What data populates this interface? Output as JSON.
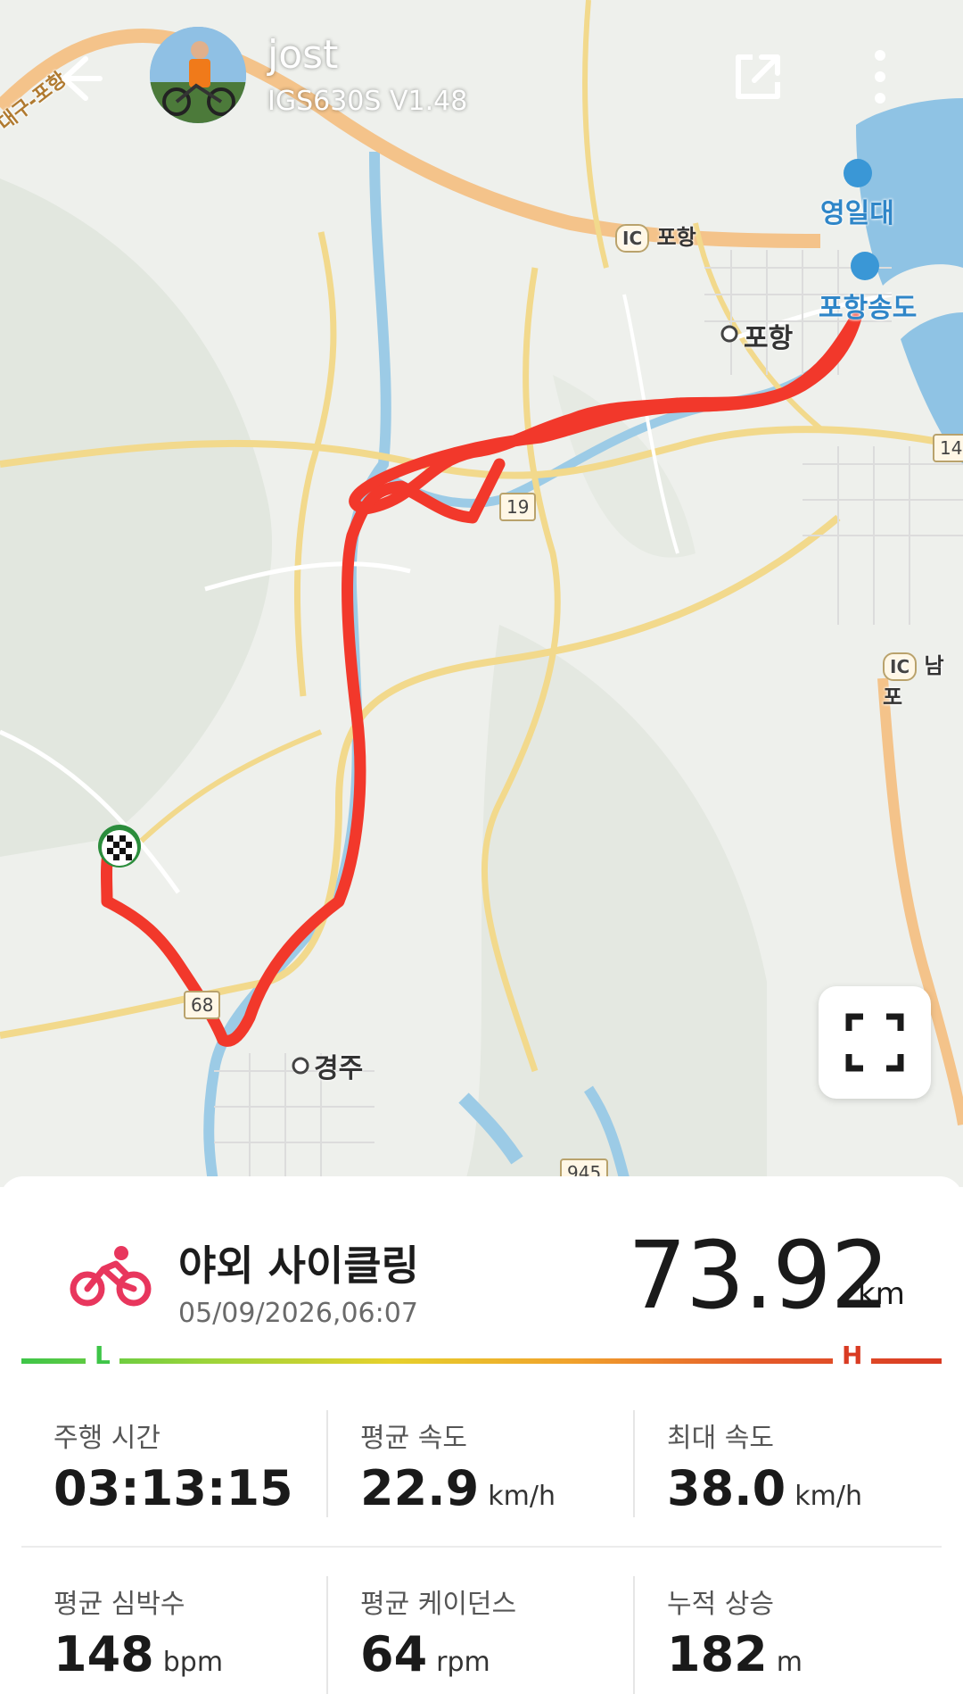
{
  "header": {
    "username": "jost",
    "device": "IGS630S V1.48"
  },
  "map": {
    "labels": {
      "yeongildae": "영일대",
      "pohang_songdo": "포항송도",
      "pohang_city": "포항",
      "pohang_ic": "포항",
      "gyeongju": "경주",
      "nampo": "남포",
      "expressway": "대구-포항",
      "ic_badge": "IC"
    },
    "road_numbers": {
      "r19": "19",
      "r68": "68",
      "r945": "945",
      "r14": "14"
    },
    "colors": {
      "route": "#f2382b",
      "river": "#9ccbe6",
      "sea": "#8fc3e4",
      "expressway": "#f4c38a",
      "major_road": "#f2d98c"
    }
  },
  "activity": {
    "type": "야외 사이클링",
    "datetime": "05/09/2026,06:07",
    "distance": "73.92",
    "distance_unit": "km",
    "intensity_low": "L",
    "intensity_high": "H",
    "icon": "bicycle-icon",
    "icon_color": "#e8365d"
  },
  "metrics": [
    {
      "label": "주행 시간",
      "value": "03:13:15",
      "unit": ""
    },
    {
      "label": "평균 속도",
      "value": "22.9",
      "unit": "km/h"
    },
    {
      "label": "최대 속도",
      "value": "38.0",
      "unit": "km/h"
    },
    {
      "label": "평균 심박수",
      "value": "148",
      "unit": "bpm"
    },
    {
      "label": "평균 케이던스",
      "value": "64",
      "unit": "rpm"
    },
    {
      "label": "누적 상승",
      "value": "182",
      "unit": "m"
    }
  ]
}
